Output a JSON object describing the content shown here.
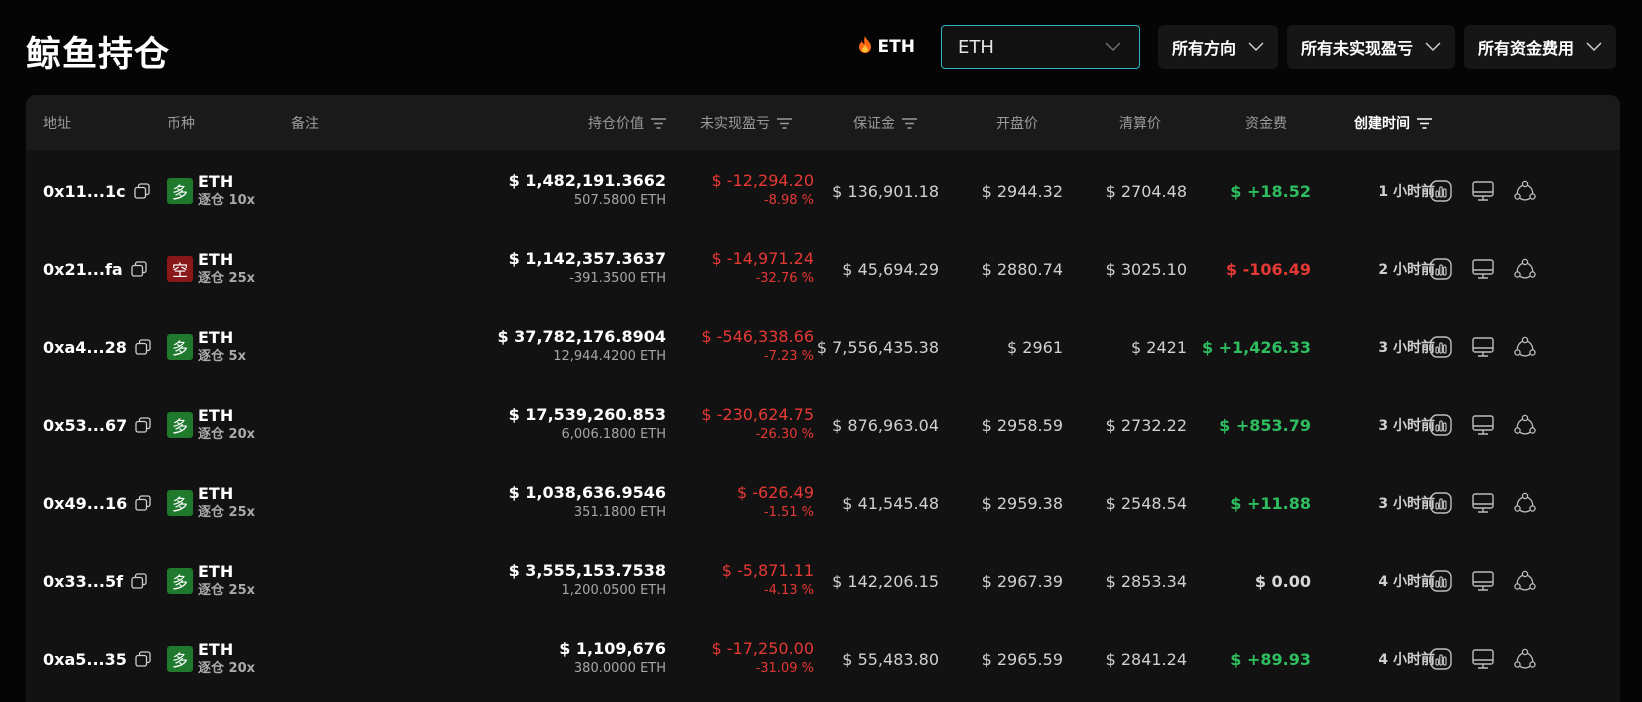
{
  "page": {
    "title": "鲸鱼持仓"
  },
  "filters": {
    "hot_tag": "ETH",
    "search_value": "ETH",
    "direction": "所有方向",
    "pnl": "所有未实现盈亏",
    "funding": "所有资金费用"
  },
  "columns": {
    "address": "地址",
    "coin": "币种",
    "note": "备注",
    "position_value": "持仓价值",
    "unrealized_pnl": "未实现盈亏",
    "margin": "保证金",
    "entry_price": "开盘价",
    "liq_price": "清算价",
    "funding": "资金费",
    "created": "创建时间"
  },
  "colors": {
    "accent": "#2ab3c4",
    "long": "#1f7a2e",
    "short": "#8a1818",
    "negative": "#e53935",
    "positive": "#2ebd5f"
  },
  "rows": [
    {
      "address": "0x11...1c",
      "dir": "多",
      "coin": "ETH",
      "leverage": "逐仓 10x",
      "value": "$ 1,482,191.3662",
      "size": "507.5800 ETH",
      "pnl": "$ -12,294.20",
      "pnl_pct": "-8.98 %",
      "margin": "$ 136,901.18",
      "entry": "$ 2944.32",
      "liq": "$ 2704.48",
      "funding": "$ +18.52",
      "funding_sign": "pos",
      "created": "1 小时前"
    },
    {
      "address": "0x21...fa",
      "dir": "空",
      "coin": "ETH",
      "leverage": "逐仓 25x",
      "value": "$ 1,142,357.3637",
      "size": "-391.3500 ETH",
      "pnl": "$ -14,971.24",
      "pnl_pct": "-32.76 %",
      "margin": "$ 45,694.29",
      "entry": "$ 2880.74",
      "liq": "$ 3025.10",
      "funding": "$ -106.49",
      "funding_sign": "neg",
      "created": "2 小时前"
    },
    {
      "address": "0xa4...28",
      "dir": "多",
      "coin": "ETH",
      "leverage": "逐仓 5x",
      "value": "$ 37,782,176.8904",
      "size": "12,944.4200 ETH",
      "pnl": "$ -546,338.66",
      "pnl_pct": "-7.23 %",
      "margin": "$ 7,556,435.38",
      "entry": "$ 2961",
      "liq": "$ 2421",
      "funding": "$ +1,426.33",
      "funding_sign": "pos",
      "created": "3 小时前"
    },
    {
      "address": "0x53...67",
      "dir": "多",
      "coin": "ETH",
      "leverage": "逐仓 20x",
      "value": "$ 17,539,260.853",
      "size": "6,006.1800 ETH",
      "pnl": "$ -230,624.75",
      "pnl_pct": "-26.30 %",
      "margin": "$ 876,963.04",
      "entry": "$ 2958.59",
      "liq": "$ 2732.22",
      "funding": "$ +853.79",
      "funding_sign": "pos",
      "created": "3 小时前"
    },
    {
      "address": "0x49...16",
      "dir": "多",
      "coin": "ETH",
      "leverage": "逐仓 25x",
      "value": "$ 1,038,636.9546",
      "size": "351.1800 ETH",
      "pnl": "$ -626.49",
      "pnl_pct": "-1.51 %",
      "margin": "$ 41,545.48",
      "entry": "$ 2959.38",
      "liq": "$ 2548.54",
      "funding": "$ +11.88",
      "funding_sign": "pos",
      "created": "3 小时前"
    },
    {
      "address": "0x33...5f",
      "dir": "多",
      "coin": "ETH",
      "leverage": "逐仓 25x",
      "value": "$ 3,555,153.7538",
      "size": "1,200.0500 ETH",
      "pnl": "$ -5,871.11",
      "pnl_pct": "-4.13 %",
      "margin": "$ 142,206.15",
      "entry": "$ 2967.39",
      "liq": "$ 2853.34",
      "funding": "$ 0.00",
      "funding_sign": "zero",
      "created": "4 小时前"
    },
    {
      "address": "0xa5...35",
      "dir": "多",
      "coin": "ETH",
      "leverage": "逐仓 20x",
      "value": "$ 1,109,676",
      "size": "380.0000 ETH",
      "pnl": "$ -17,250.00",
      "pnl_pct": "-31.09 %",
      "margin": "$ 55,483.80",
      "entry": "$ 2965.59",
      "liq": "$ 2841.24",
      "funding": "$ +89.93",
      "funding_sign": "pos",
      "created": "4 小时前"
    }
  ]
}
